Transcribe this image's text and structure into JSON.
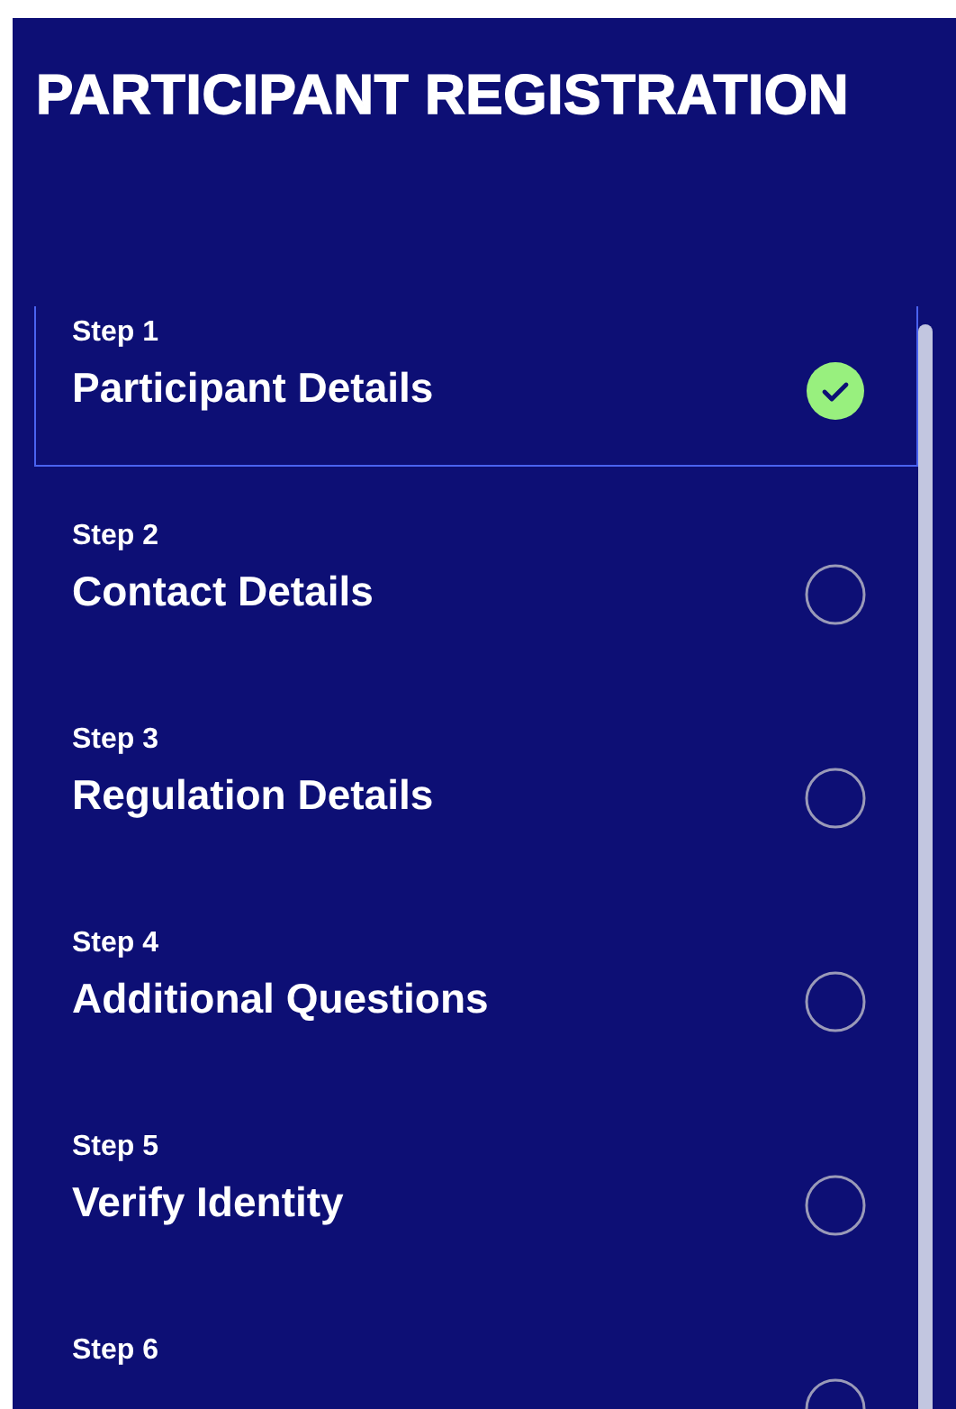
{
  "title": "PARTICIPANT REGISTRATION",
  "steps": [
    {
      "label": "Step 1",
      "title": "Participant Details",
      "selected": true,
      "completed": true
    },
    {
      "label": "Step 2",
      "title": "Contact Details",
      "selected": false,
      "completed": false
    },
    {
      "label": "Step 3",
      "title": "Regulation Details",
      "selected": false,
      "completed": false
    },
    {
      "label": "Step 4",
      "title": "Additional Questions",
      "selected": false,
      "completed": false
    },
    {
      "label": "Step 5",
      "title": "Verify Identity",
      "selected": false,
      "completed": false
    },
    {
      "label": "Step 6",
      "selected": false,
      "completed": false
    }
  ]
}
